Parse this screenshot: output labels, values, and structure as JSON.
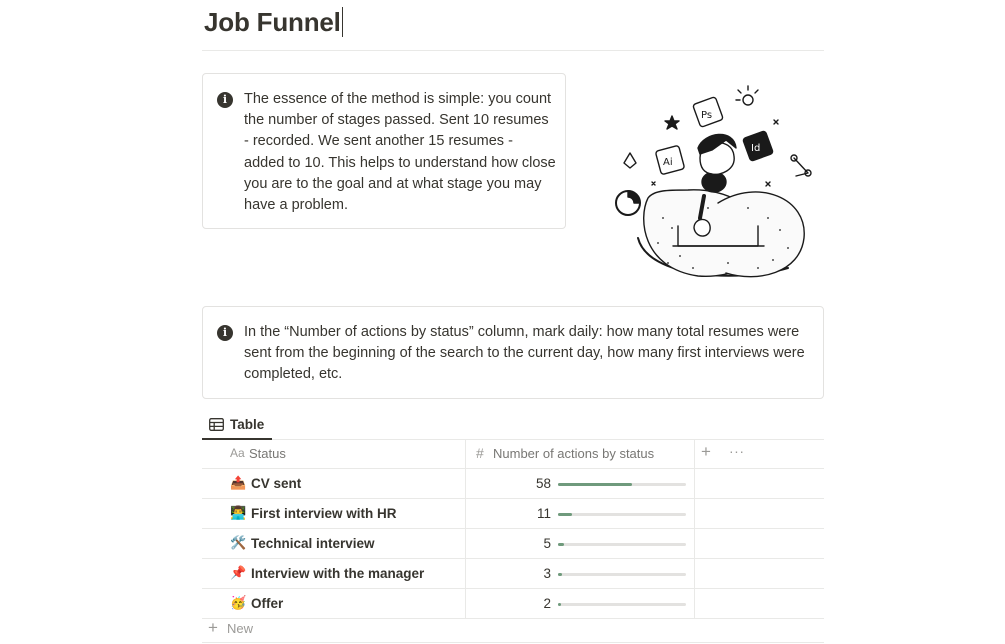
{
  "page": {
    "title": "Job Funnel"
  },
  "callouts": [
    {
      "icon": "info-icon",
      "text": "The essence of the method is simple: you count the number of stages passed. Sent 10 resumes - recorded. We sent another 15 resumes - added to 10. This helps to understand how close you are to the goal and at what stage you may have a problem."
    },
    {
      "icon": "info-icon",
      "text": "In the “Number of actions by status” column, mark daily: how many total resumes were sent from the beginning of the search to the current day, how many first interviews were completed, etc."
    }
  ],
  "view": {
    "tab_label": "Table",
    "tab_icon": "table-icon"
  },
  "table": {
    "columns": [
      {
        "prefix": "Aa",
        "label": "Status"
      },
      {
        "prefix": "#",
        "label": "Number of actions by status"
      }
    ],
    "add_column": "+",
    "more": "···",
    "rows": [
      {
        "emoji": "📤",
        "status": "CV sent",
        "count": "58",
        "progress": 0.58
      },
      {
        "emoji": "👨‍💻",
        "status": "First interview with HR",
        "count": "11",
        "progress": 0.11
      },
      {
        "emoji": "🛠️",
        "status": "Technical interview",
        "count": "5",
        "progress": 0.05
      },
      {
        "emoji": "📌",
        "status": "Interview with the manager",
        "count": "3",
        "progress": 0.03
      },
      {
        "emoji": "🥳",
        "status": "Offer",
        "count": "2",
        "progress": 0.02
      }
    ],
    "new_label": "New"
  },
  "colors": {
    "progress_fill": "#6f9a7c",
    "progress_track": "#e3e2e0",
    "text": "#37352f"
  }
}
